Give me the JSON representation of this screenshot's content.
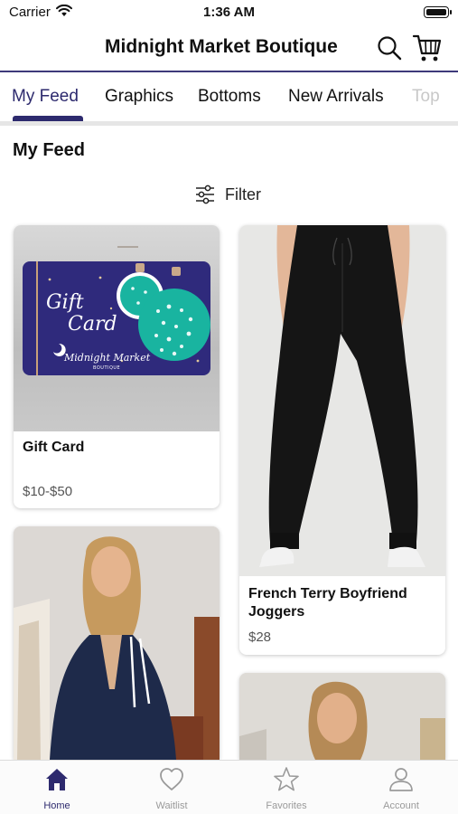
{
  "status_bar": {
    "carrier": "Carrier",
    "time": "1:36 AM"
  },
  "header": {
    "title": "Midnight Market Boutique"
  },
  "tabs": [
    {
      "label": "My Feed",
      "active": true
    },
    {
      "label": "Graphics"
    },
    {
      "label": "Bottoms"
    },
    {
      "label": "New Arrivals"
    },
    {
      "label": "Top"
    }
  ],
  "feed": {
    "title": "My Feed",
    "filter_label": "Filter",
    "products": [
      {
        "name": "Gift Card",
        "price": "$10-$50"
      },
      {
        "name": "French Terry Boyfriend Joggers",
        "price": "$28"
      }
    ],
    "gift_card_art": {
      "line1": "Gift",
      "line2": "Card",
      "brand": "Midnight Market",
      "brand_sub": "BOUTIQUE"
    }
  },
  "bottom_nav": [
    {
      "label": "Home",
      "icon": "home-icon",
      "active": true
    },
    {
      "label": "Waitlist",
      "icon": "heart-icon"
    },
    {
      "label": "Favorites",
      "icon": "star-icon"
    },
    {
      "label": "Account",
      "icon": "account-icon"
    }
  ],
  "colors": {
    "brand": "#2d2a6e",
    "gift_card_bg": "#2f2a7c",
    "ornament": "#19b4a0"
  }
}
